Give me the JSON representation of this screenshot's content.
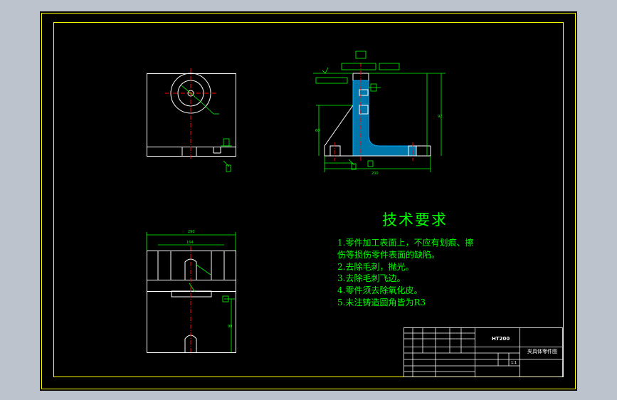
{
  "technical_requirements": {
    "title": "技术要求",
    "lines": [
      "1.零件加工表面上，不应有划痕、擦",
      "伤等损伤零件表面的缺陷。",
      "2.去除毛刺，抛光。",
      "3.去除毛刺飞边。",
      "4.零件须去除氧化皮。",
      "5.未注铸造圆角皆为R3"
    ]
  },
  "title_block": {
    "material": "HT200",
    "part_name": "夹具体零件图",
    "scale": "1:1"
  },
  "colors": {
    "outer_background": "#bcc3cd",
    "paper": "#000000",
    "border": "#ffff00",
    "geometry": "#ffffff",
    "dimensions": "#00ff00",
    "centerlines": "#ff0000",
    "hatch": "#00aaff",
    "text": "#00ff00"
  }
}
